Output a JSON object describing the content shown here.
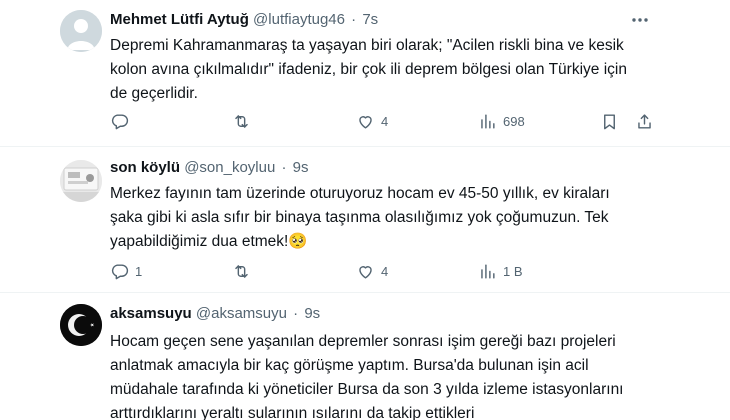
{
  "tweets": [
    {
      "name": "Mehmet Lütfi Aytuğ",
      "handle": "@lutfiaytug46",
      "separator": "·",
      "time": "7s",
      "text_lines": [
        "Depremi Kahramanmaraş ta yaşayan biri olarak; \"Acilen riskli bina ve kesik",
        "kolon avına çıkılmalıdır\"  ifadeniz, bir çok ili deprem bölgesi olan Türkiye için",
        "de geçerlidir."
      ],
      "reply_count": "",
      "retweet_count": "",
      "like_count": "4",
      "view_count": "698"
    },
    {
      "name": "son köylü",
      "handle": "@son_koyluu",
      "separator": "·",
      "time": "9s",
      "text_lines": [
        "Merkez fayının tam üzerinde oturuyoruz hocam ev 45-50 yıllık, ev kiraları",
        "şaka gibi ki asla sıfır bir binaya taşınma olasılığımız yok çoğumuzun. Tek",
        "yapabildiğimiz dua etmek!🥺"
      ],
      "reply_count": "1",
      "retweet_count": "",
      "like_count": "4",
      "view_count": "1 B"
    },
    {
      "name": "aksamsuyu",
      "handle": "@aksamsuyu",
      "separator": "·",
      "time": "9s",
      "text_lines": [
        "Hocam geçen sene yaşanılan depremler sonrası işim gereği bazı projeleri",
        "anlatmak amacıyla bir kaç görüşme yaptım. Bursa'da bulunan işin acil",
        "müdahale tarafında ki yöneticiler Bursa da son 3 yılda izleme istasyonlarını",
        "arttırdıklarını yeraltı sularının ısılarını da takip ettikleri"
      ]
    }
  ],
  "icons": {
    "more": "more-horizontal-icon",
    "reply": "reply-bubble-icon",
    "retweet": "retweet-icon",
    "like": "heart-icon",
    "views": "bar-chart-icon",
    "bookmark": "bookmark-icon",
    "share": "share-icon"
  },
  "colors": {
    "text": "#0f1419",
    "secondary": "#536471",
    "divider": "#eff3f4"
  }
}
